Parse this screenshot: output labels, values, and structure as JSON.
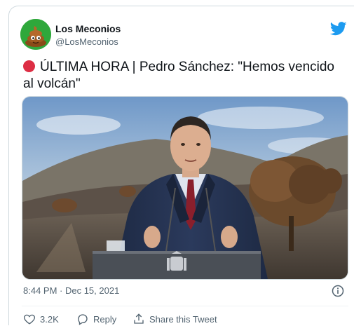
{
  "tweet": {
    "author_name": "Los Meconios",
    "author_handle": "@LosMeconios",
    "text": "ÚLTIMA HORA | Pedro Sánchez: \"Hemos vencido al volcán\"",
    "timestamp": "8:44 PM · Dec 15, 2021",
    "like_count": "3.2K",
    "reply_label": "Reply",
    "share_label": "Share this Tweet"
  },
  "icons": {
    "brand": "twitter-bird-icon",
    "like": "heart-icon",
    "reply": "speech-bubble-icon",
    "share": "share-icon",
    "info": "info-icon",
    "emoji": "red-circle-icon"
  },
  "colors": {
    "twitter_blue": "#1d9bf0",
    "secondary_text": "#536471",
    "red_circle": "#dd2e44",
    "avatar_green": "#2fa83b"
  }
}
